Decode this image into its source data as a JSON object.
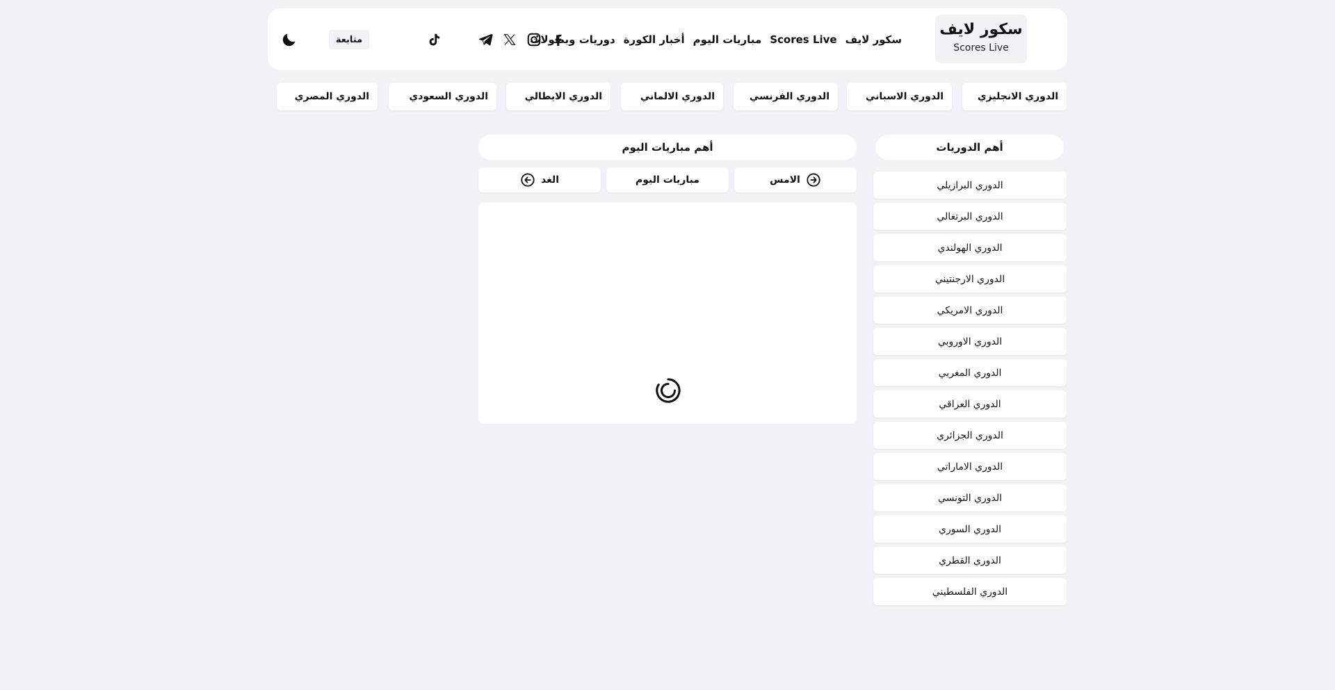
{
  "header": {
    "logo_title": "سكور لايف",
    "logo_subtitle": "Scores Live",
    "nav": [
      {
        "label": "سكور لايف"
      },
      {
        "label": "Scores Live"
      },
      {
        "label": "مباريات اليوم"
      },
      {
        "label": "أخبار الكورة"
      },
      {
        "label": "دوريات وبطولات"
      }
    ],
    "socials": [
      "facebook-icon",
      "instagram-icon",
      "x-icon",
      "telegram-icon",
      "tiktok-icon"
    ],
    "follow_label": "متابعة",
    "theme_icon": "moon-icon"
  },
  "league_tabs": [
    {
      "label": "الدوري الانجليزي"
    },
    {
      "label": "الدوري الاسباني"
    },
    {
      "label": "الدوري الفرنسي"
    },
    {
      "label": "الدوري الالماني"
    },
    {
      "label": "الدوري الايطالي"
    },
    {
      "label": "الدوري السعودي"
    },
    {
      "label": "الدوري المصري"
    }
  ],
  "sidebar": {
    "title": "أهم الدوريات",
    "items": [
      {
        "label": "الدوري البرازيلي"
      },
      {
        "label": "الدوري البرتغالي"
      },
      {
        "label": "الدوري الهولندي"
      },
      {
        "label": "الدوري الارجنتيني"
      },
      {
        "label": "الدوري الامريكي"
      },
      {
        "label": "الدوري الاوروبي"
      },
      {
        "label": "الدوري المغربي"
      },
      {
        "label": "الدوري العراقي"
      },
      {
        "label": "الدوري الجزائري"
      },
      {
        "label": "الدوري الاماراتي"
      },
      {
        "label": "الدوري التونسي"
      },
      {
        "label": "الدوري السوري"
      },
      {
        "label": "الدوري القطري"
      },
      {
        "label": "الدوري الفلسطيني"
      }
    ]
  },
  "matches": {
    "title": "أهم مباريات اليوم",
    "yesterday_label": "الامس",
    "today_label": "مباريات اليوم",
    "tomorrow_label": "الغد",
    "loading_icon": "loading-spinner-icon"
  },
  "colors": {
    "page_bg": "#f1f2f5",
    "card_bg": "#ffffff",
    "text": "#111111"
  }
}
